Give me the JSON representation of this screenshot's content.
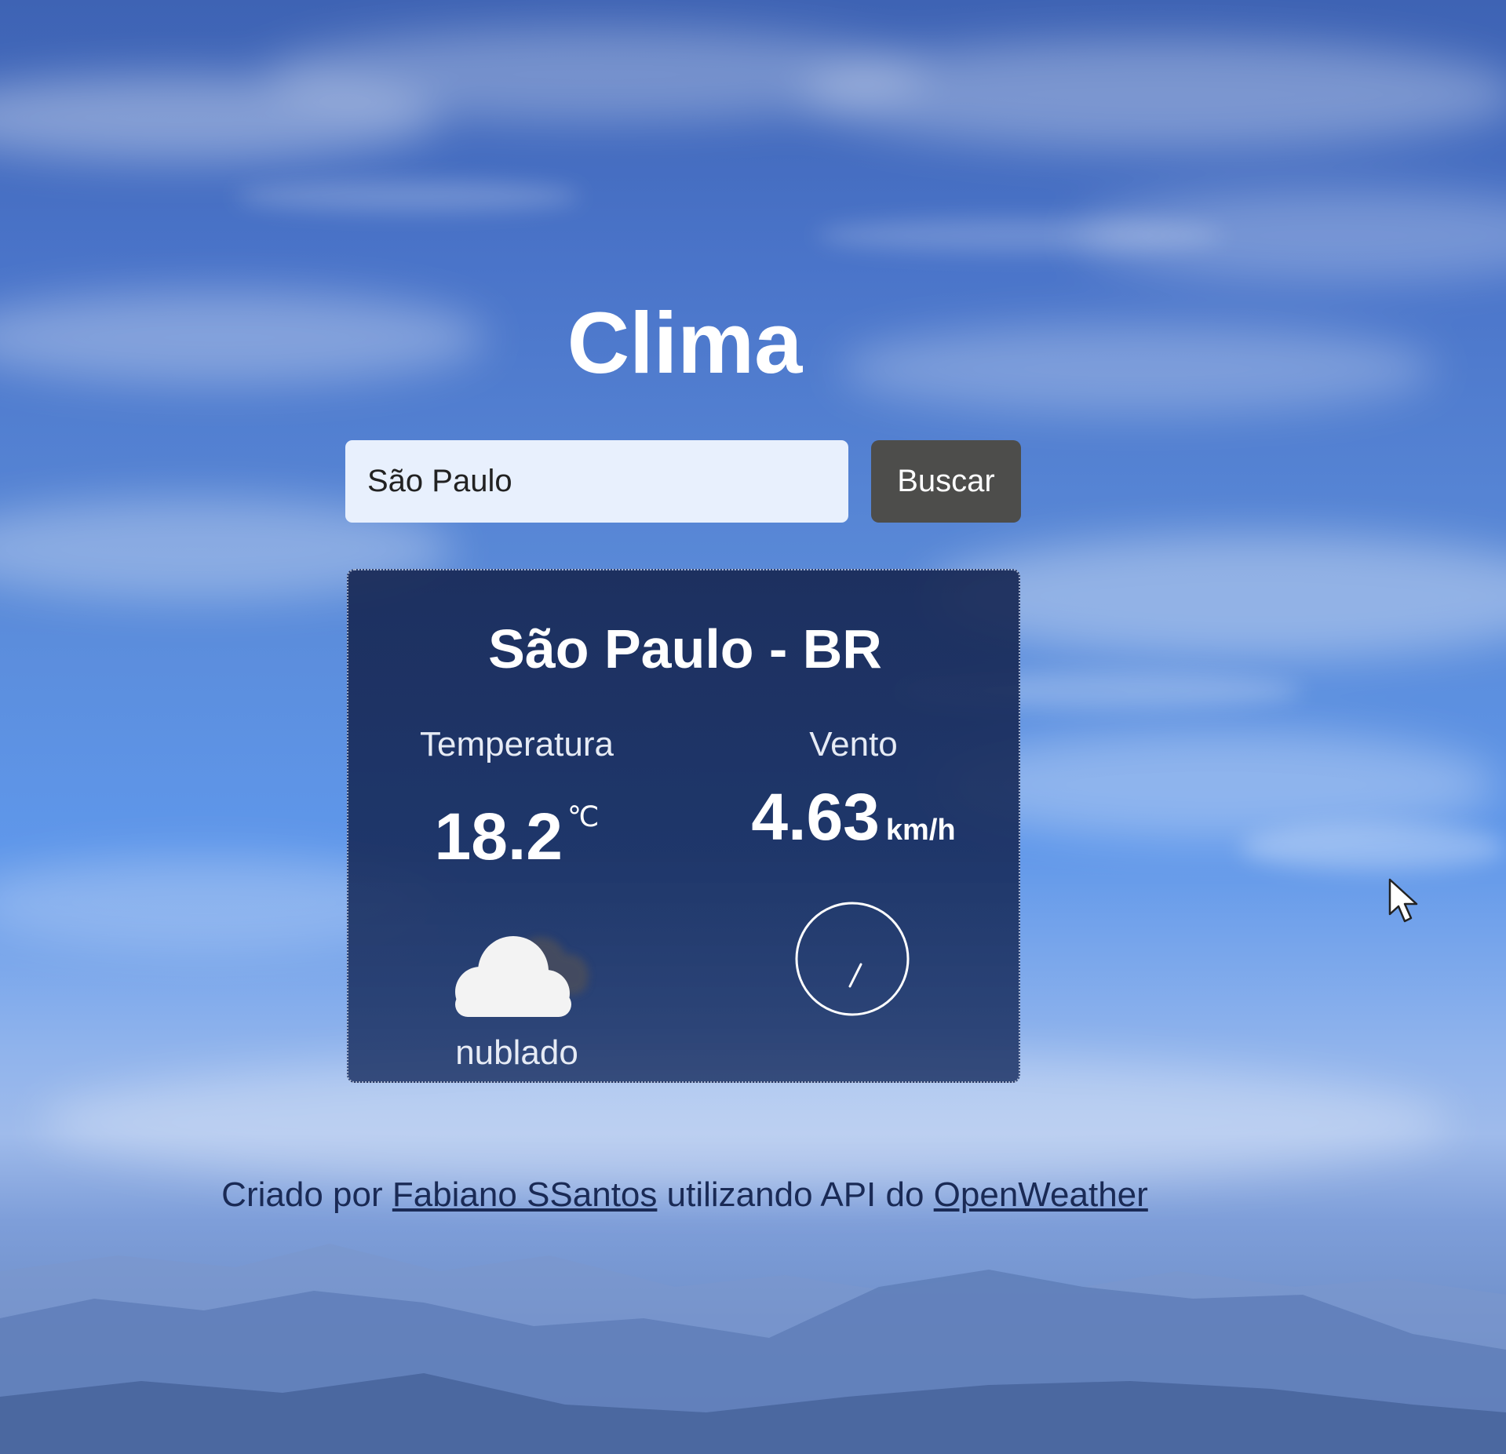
{
  "header": {
    "title": "Clima"
  },
  "search": {
    "value": "São Paulo",
    "button_label": "Buscar"
  },
  "weather": {
    "location": "São Paulo - BR",
    "temperature_label": "Temperatura",
    "temperature_value": "18.2",
    "temperature_unit": "℃",
    "wind_label": "Vento",
    "wind_value": "4.63",
    "wind_unit": "km/h",
    "description": "nublado",
    "condition_icon": "cloud-icon",
    "wind_direction_icon": "compass-icon"
  },
  "footer": {
    "prefix": "Criado por",
    "author_link": "Fabiano SSantos",
    "middle": "utilizando API do",
    "api_link": "OpenWeather"
  },
  "colors": {
    "card_background": "#1a2d5e",
    "button_background": "#4d4d4b",
    "input_background": "#e8f0fd",
    "footer_text": "#1a2a55"
  }
}
